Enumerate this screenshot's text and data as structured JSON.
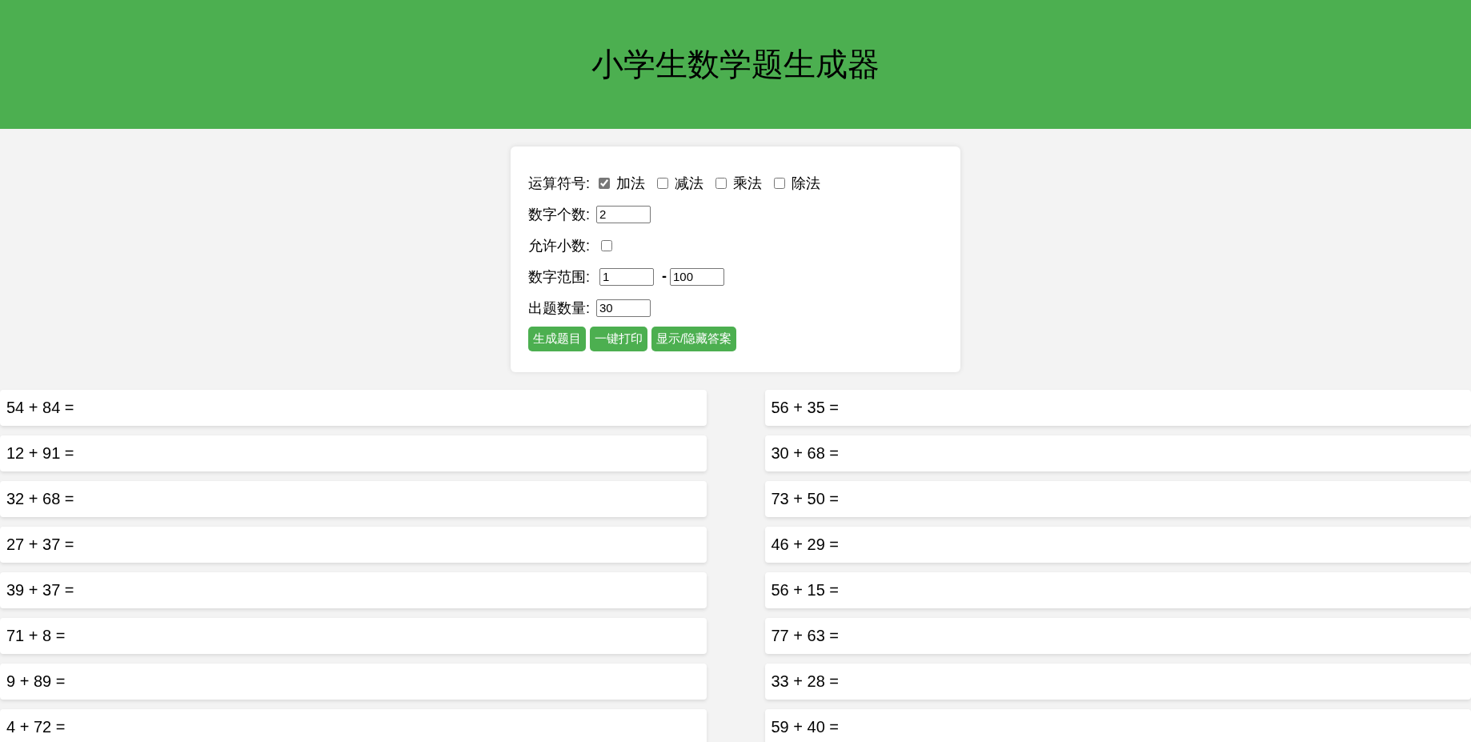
{
  "header": {
    "title": "小学生数学题生成器"
  },
  "settings": {
    "operators": {
      "label": "运算符号:",
      "options": [
        {
          "label": "加法",
          "checked": true
        },
        {
          "label": "减法",
          "checked": false
        },
        {
          "label": "乘法",
          "checked": false
        },
        {
          "label": "除法",
          "checked": false
        }
      ]
    },
    "number_count": {
      "label": "数字个数:",
      "value": "2"
    },
    "allow_decimal": {
      "label": "允许小数:",
      "checked": false
    },
    "range": {
      "label": "数字范围:",
      "min": "1",
      "separator": "-",
      "max": "100"
    },
    "question_count": {
      "label": "出题数量:",
      "value": "30"
    },
    "buttons": [
      "生成题目",
      "一键打印",
      "显示/隐藏答案"
    ]
  },
  "problems": [
    "54 + 84 =",
    "56 + 35 =",
    "12 + 91 =",
    "30 + 68 =",
    "32 + 68 =",
    "73 + 50 =",
    "27 + 37 =",
    "46 + 29 =",
    "39 + 37 =",
    "56 + 15 =",
    "71 + 8 =",
    "77 + 63 =",
    "9 + 89 =",
    "33 + 28 =",
    "4 + 72 =",
    "59 + 40 ="
  ]
}
